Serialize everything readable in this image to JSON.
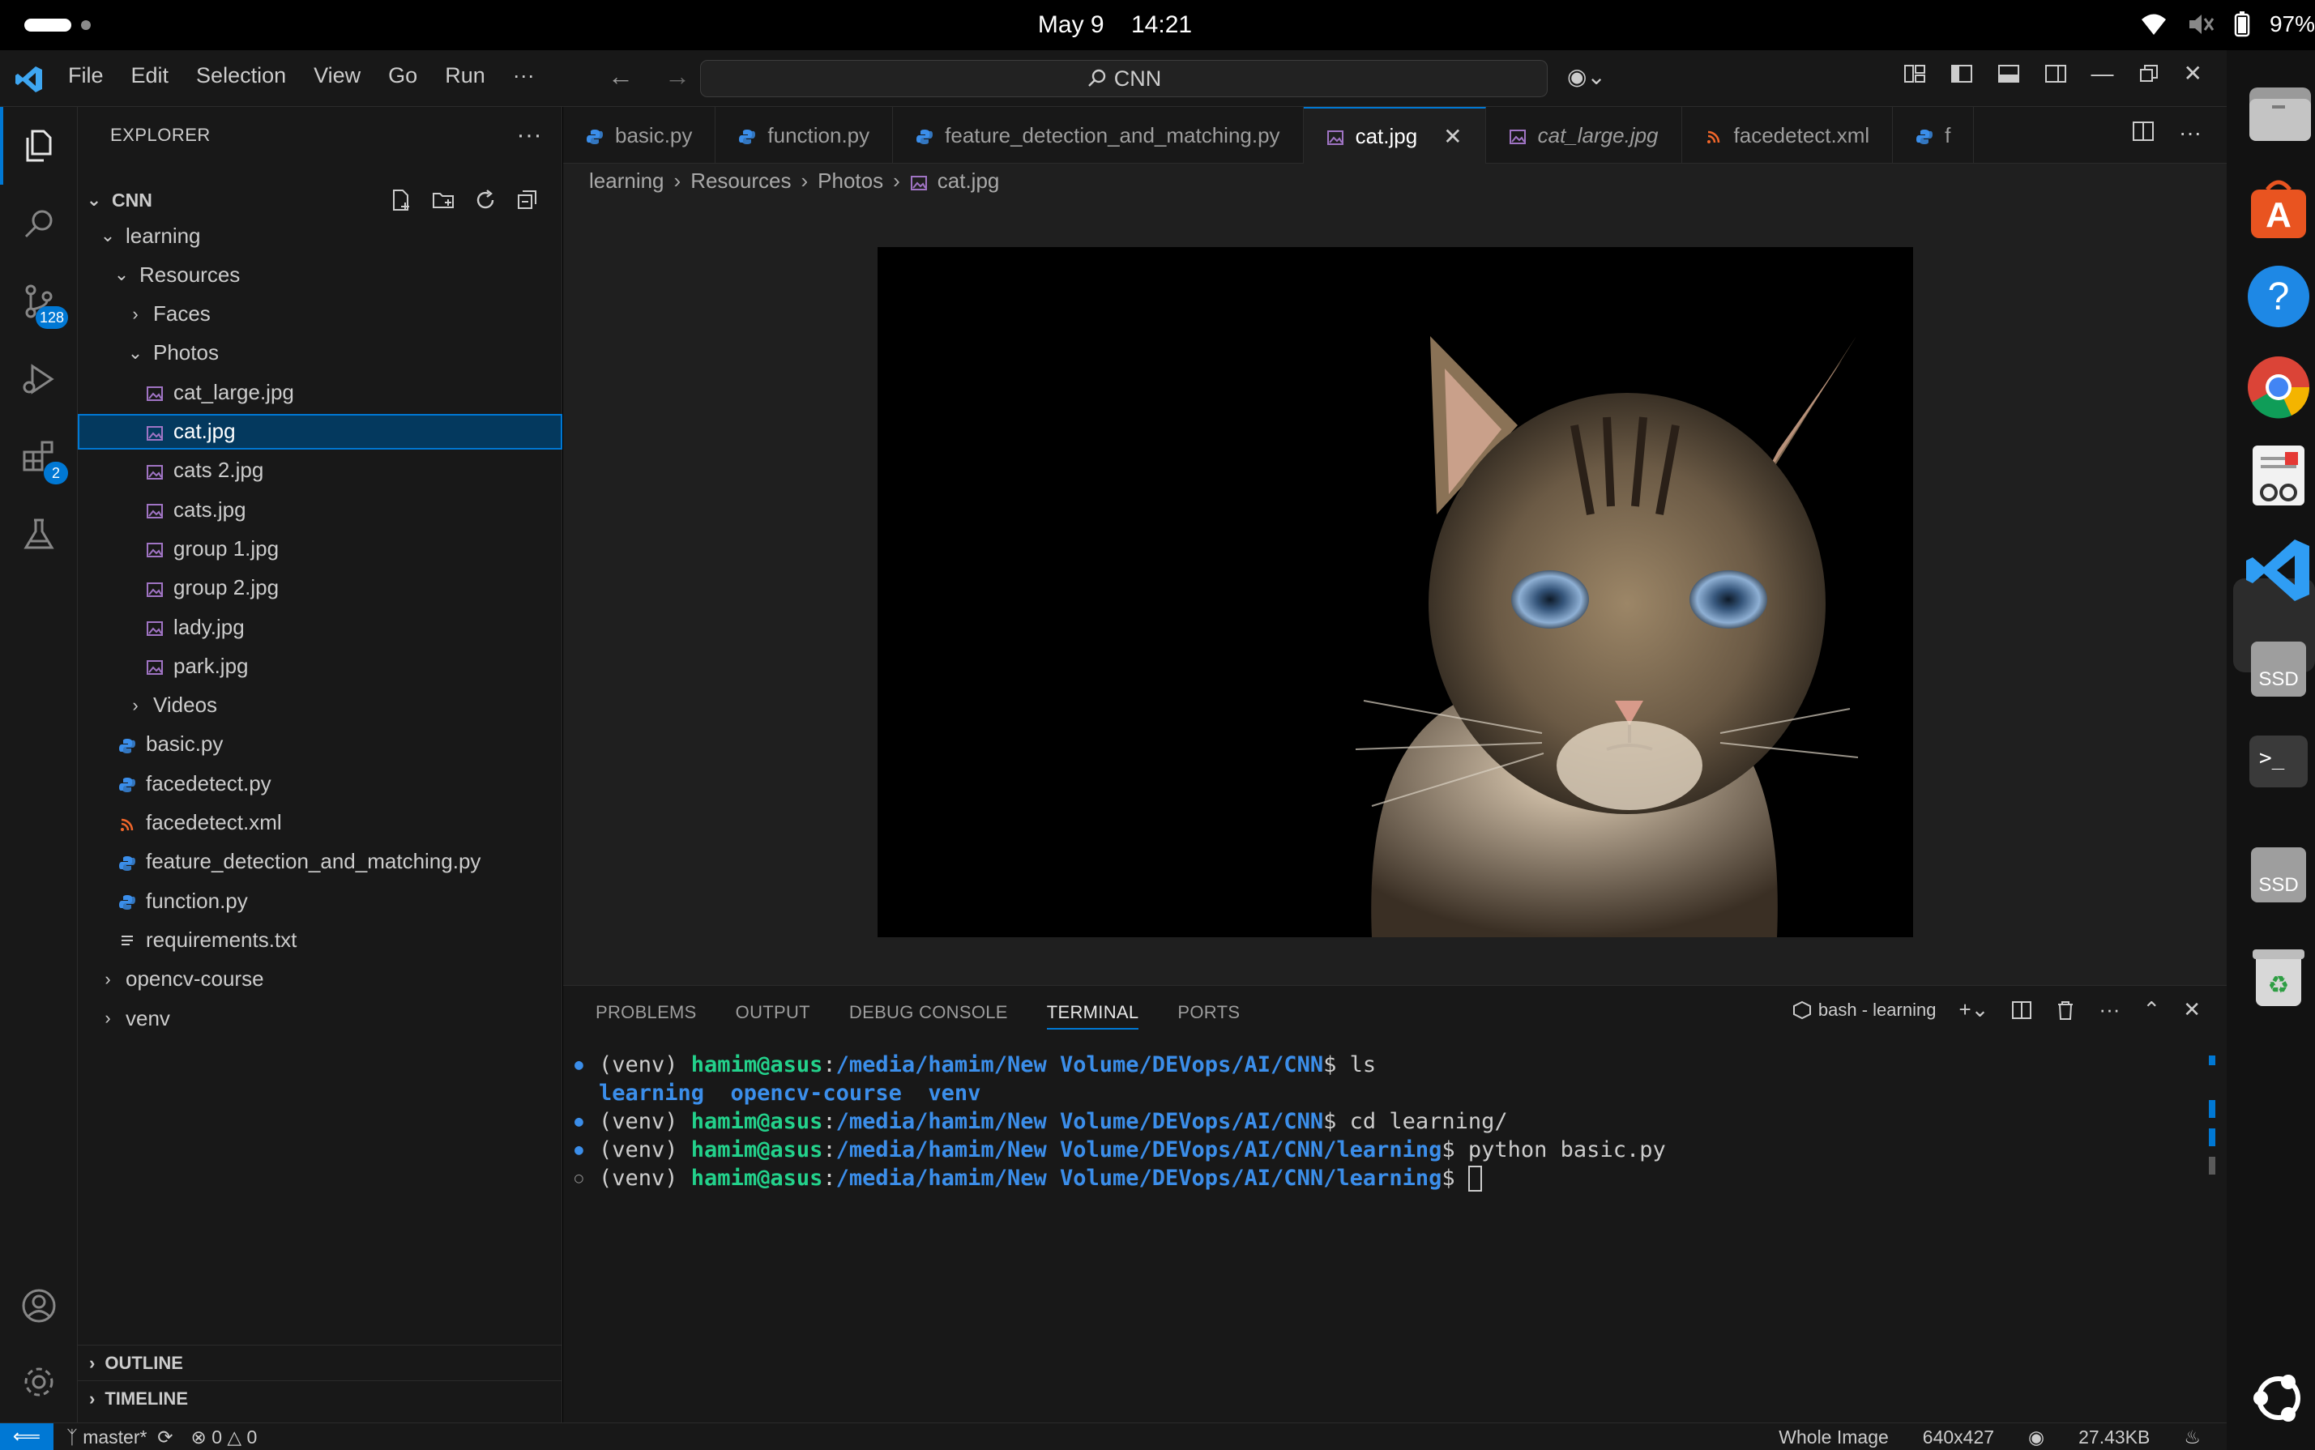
{
  "system": {
    "date": "May 9",
    "time": "14:21",
    "battery": "97%"
  },
  "titlebar": {
    "menu": [
      "File",
      "Edit",
      "Selection",
      "View",
      "Go",
      "Run",
      "···"
    ],
    "search": "CNN"
  },
  "activitybar": {
    "source_control_badge": "128",
    "extensions_badge": "2"
  },
  "explorer": {
    "title": "EXPLORER",
    "more": "···",
    "root": "CNN",
    "tree": [
      {
        "label": "learning",
        "depth": 1,
        "type": "folder-open"
      },
      {
        "label": "Resources",
        "depth": 2,
        "type": "folder-open"
      },
      {
        "label": "Faces",
        "depth": 3,
        "type": "folder"
      },
      {
        "label": "Photos",
        "depth": 3,
        "type": "folder-open"
      },
      {
        "label": "cat_large.jpg",
        "depth": 4,
        "type": "image"
      },
      {
        "label": "cat.jpg",
        "depth": 4,
        "type": "image",
        "selected": true
      },
      {
        "label": "cats 2.jpg",
        "depth": 4,
        "type": "image"
      },
      {
        "label": "cats.jpg",
        "depth": 4,
        "type": "image"
      },
      {
        "label": "group 1.jpg",
        "depth": 4,
        "type": "image"
      },
      {
        "label": "group 2.jpg",
        "depth": 4,
        "type": "image"
      },
      {
        "label": "lady.jpg",
        "depth": 4,
        "type": "image"
      },
      {
        "label": "park.jpg",
        "depth": 4,
        "type": "image"
      },
      {
        "label": "Videos",
        "depth": 3,
        "type": "folder"
      },
      {
        "label": "basic.py",
        "depth": 2,
        "type": "python"
      },
      {
        "label": "facedetect.py",
        "depth": 2,
        "type": "python"
      },
      {
        "label": "facedetect.xml",
        "depth": 2,
        "type": "xml"
      },
      {
        "label": "feature_detection_and_matching.py",
        "depth": 2,
        "type": "python"
      },
      {
        "label": "function.py",
        "depth": 2,
        "type": "python"
      },
      {
        "label": "requirements.txt",
        "depth": 2,
        "type": "text"
      },
      {
        "label": "opencv-course",
        "depth": 1,
        "type": "folder"
      },
      {
        "label": "venv",
        "depth": 1,
        "type": "folder"
      }
    ],
    "outline": "OUTLINE",
    "timeline": "TIMELINE"
  },
  "tabs": [
    {
      "label": "basic.py",
      "type": "python"
    },
    {
      "label": "function.py",
      "type": "python"
    },
    {
      "label": "feature_detection_and_matching.py",
      "type": "python"
    },
    {
      "label": "cat.jpg",
      "type": "image",
      "active": true
    },
    {
      "label": "cat_large.jpg",
      "type": "image",
      "italic": true
    },
    {
      "label": "facedetect.xml",
      "type": "xml"
    },
    {
      "label": "f",
      "type": "python"
    }
  ],
  "breadcrumb": [
    "learning",
    "Resources",
    "Photos",
    "cat.jpg"
  ],
  "panel": {
    "tabs": [
      "PROBLEMS",
      "OUTPUT",
      "DEBUG CONSOLE",
      "TERMINAL",
      "PORTS"
    ],
    "active_tab": "TERMINAL",
    "terminal_name": "bash - learning"
  },
  "terminal": {
    "lines": [
      {
        "dot": "●",
        "venv": "(venv) ",
        "user": "hamim@asus",
        "colon": ":",
        "path": "/media/hamim/New Volume/DEVops/AI/CNN",
        "cmd": "$ ls"
      },
      {
        "output": "learning  opencv-course  venv"
      },
      {
        "dot": "●",
        "venv": "(venv) ",
        "user": "hamim@asus",
        "colon": ":",
        "path": "/media/hamim/New Volume/DEVops/AI/CNN",
        "cmd": "$ cd learning/"
      },
      {
        "dot": "●",
        "venv": "(venv) ",
        "user": "hamim@asus",
        "colon": ":",
        "path": "/media/hamim/New Volume/DEVops/AI/CNN/learning",
        "cmd": "$ python basic.py"
      },
      {
        "dot": "○",
        "venv": "(venv) ",
        "user": "hamim@asus",
        "colon": ":",
        "path": "/media/hamim/New Volume/DEVops/AI/CNN/learning",
        "cmd": "$ ",
        "cursor": true
      }
    ]
  },
  "statusbar": {
    "branch": "master*",
    "errors": "0",
    "warnings": "0",
    "image_mode": "Whole Image",
    "dimensions": "640x427",
    "file_size": "27.43KB"
  },
  "colors": {
    "accent": "#0078d4",
    "python_icon": "#3b8eea",
    "image_icon": "#a074c4",
    "xml_icon": "#f1662a"
  }
}
